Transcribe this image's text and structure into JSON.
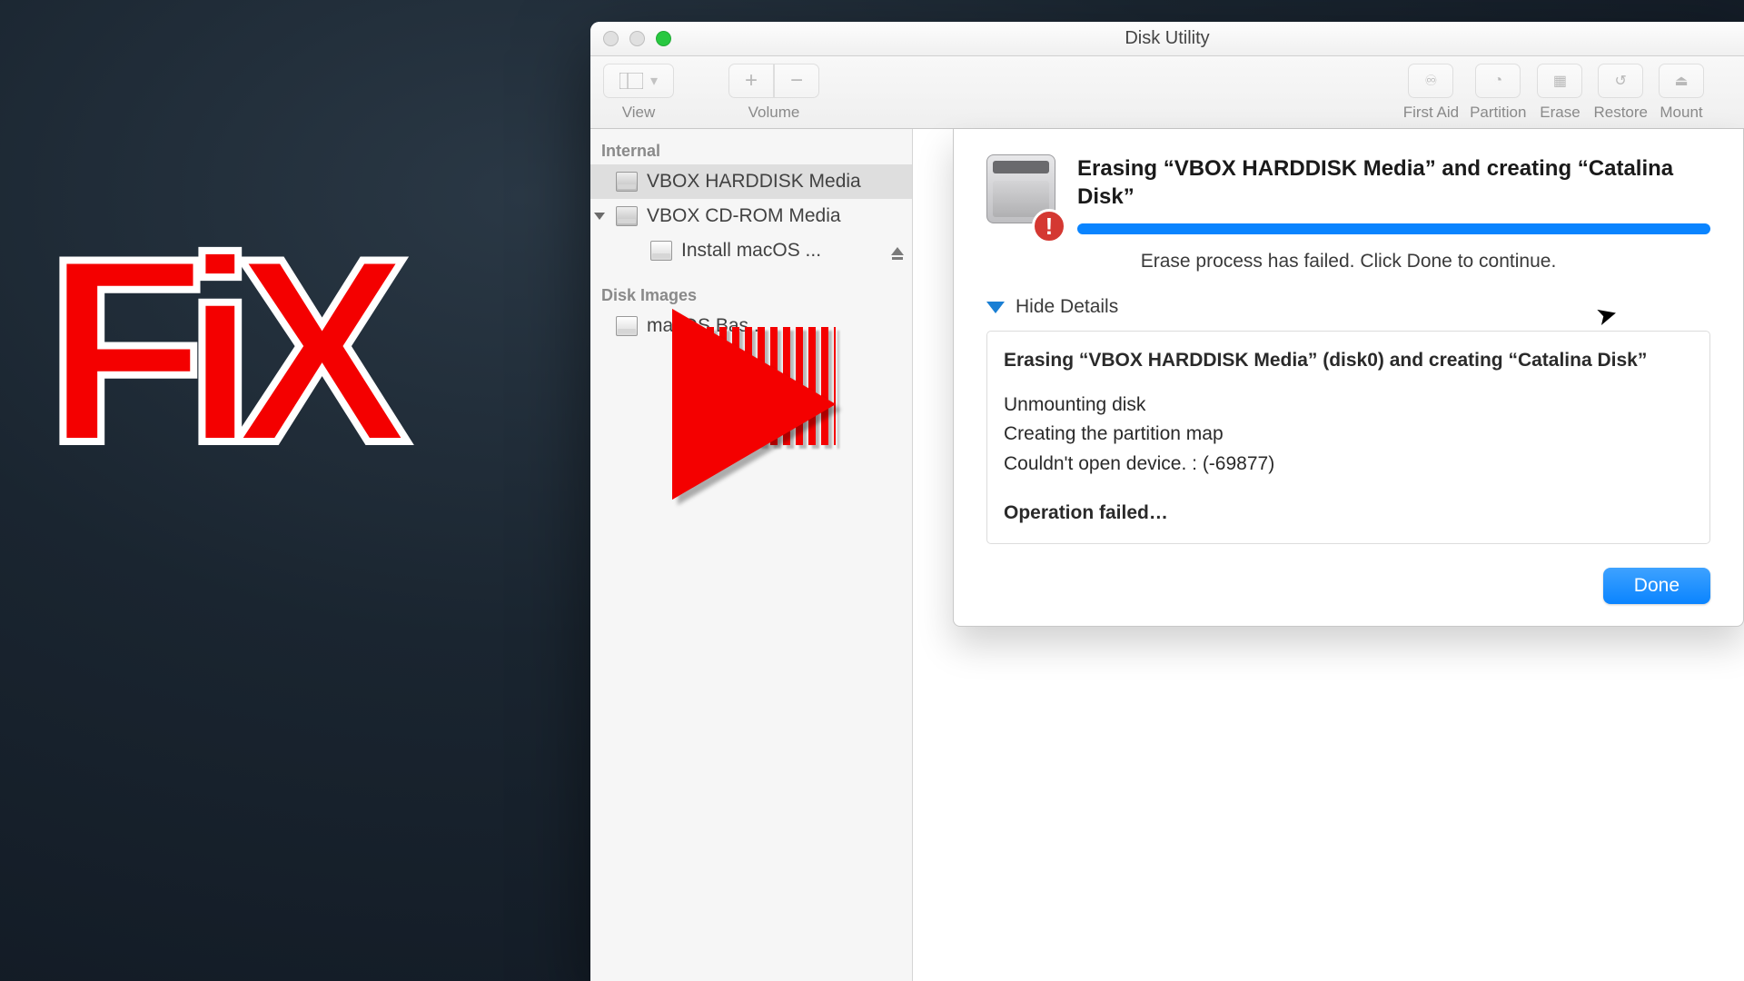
{
  "overlay_text": "FiX",
  "window": {
    "title": "Disk Utility",
    "toolbar": {
      "view": "View",
      "volume": "Volume",
      "first_aid": "First Aid",
      "partition": "Partition",
      "erase": "Erase",
      "restore": "Restore",
      "mount": "Mount"
    }
  },
  "sidebar": {
    "section_internal": "Internal",
    "item_harddisk": "VBOX HARDDISK Media",
    "item_cdrom": "VBOX CD-ROM Media",
    "item_install": "Install macOS ...",
    "section_images": "Disk Images",
    "item_image": "macOS Bas..."
  },
  "sheet": {
    "title": "Erasing “VBOX HARDDISK Media” and creating “Catalina Disk”",
    "status": "Erase process has failed. Click Done to continue.",
    "toggle": "Hide Details",
    "details_header": "Erasing “VBOX HARDDISK Media” (disk0) and creating “Catalina Disk”",
    "line1": "Unmounting disk",
    "line2": "Creating the partition map",
    "line3": "Couldn't open device. : (-69877)",
    "failed": "Operation failed…",
    "done": "Done"
  },
  "colors": {
    "accent_blue": "#0a84ff",
    "overlay_red": "#f40000"
  }
}
